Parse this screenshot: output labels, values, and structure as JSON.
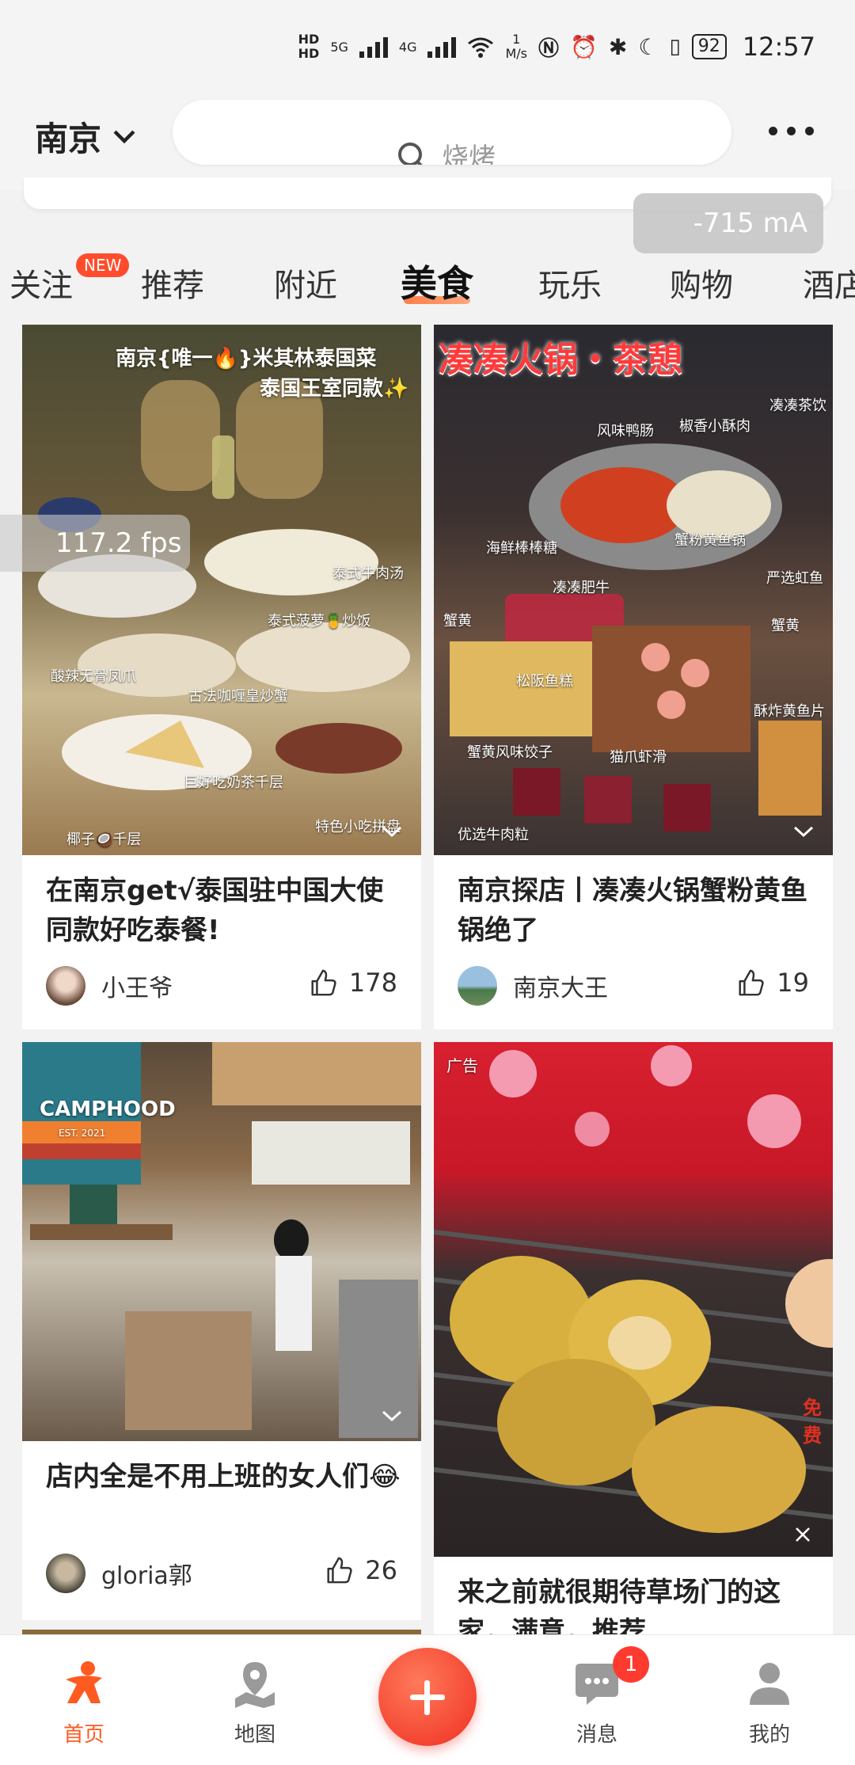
{
  "status_bar": {
    "hd1": "HD",
    "hd2": "HD",
    "sig1": "5G",
    "sig2": "4G",
    "wifi_speed": "1",
    "wifi_unit": "M/s",
    "battery": "92",
    "time": "12:57",
    "icons": [
      "nfc-icon",
      "alarm-icon",
      "bluetooth-icon",
      "moon-icon",
      "vibrate-icon"
    ]
  },
  "header": {
    "city": "南京",
    "search_placeholder": "烧烤"
  },
  "overlay": {
    "current": "-715 mA",
    "fps": "117.2 fps"
  },
  "tabs": [
    {
      "label": "关注",
      "badge": "NEW"
    },
    {
      "label": "推荐"
    },
    {
      "label": "附近"
    },
    {
      "label": "美食",
      "active": true
    },
    {
      "label": "玩乐"
    },
    {
      "label": "购物"
    },
    {
      "label": "酒店"
    }
  ],
  "feed": [
    {
      "image_texts": [
        "南京{唯一🔥}米其林泰国菜",
        "泰国王室同款✨",
        "泰式牛肉汤",
        "泰式菠萝🍍炒饭",
        "酸辣无骨凤爪",
        "古法咖喱皇炒蟹",
        "巨好吃奶茶千层",
        "特色小吃拼盘",
        "椰子🥥千层"
      ],
      "title": "在南京get√泰国驻中国大使同款好吃泰餐!",
      "author": "小王爷",
      "likes": "178"
    },
    {
      "image_texts": [
        "凑凑火锅・茶憩",
        "凑凑茶饮",
        "风味鸭肠",
        "椒香小酥肉",
        "蟹粉黄鱼锅",
        "海鲜棒棒糖",
        "凑凑肥牛",
        "严选虹鱼",
        "蟹黄",
        "蟹黄",
        "松阪鱼糕",
        "酥炸黄鱼片",
        "蟹黄风味饺子",
        "猫爪虾滑",
        "优选牛肉粒"
      ],
      "title": "南京探店丨凑凑火锅蟹粉黄鱼锅绝了",
      "author": "南京大王",
      "likes": "19"
    },
    {
      "image_texts": [
        "CAMPHOOD",
        "EST. 2021"
      ],
      "title": "店内全是不用上班的女人们😂",
      "author": "gloria郭",
      "likes": "26"
    },
    {
      "ad_label": "广告",
      "side_label": "免费",
      "title": "来之前就很期待草场门的这家，满意，推荐",
      "author": "",
      "likes": ""
    }
  ],
  "bottom_nav": {
    "home": "首页",
    "map": "地图",
    "messages": "消息",
    "messages_badge": "1",
    "me": "我的"
  }
}
